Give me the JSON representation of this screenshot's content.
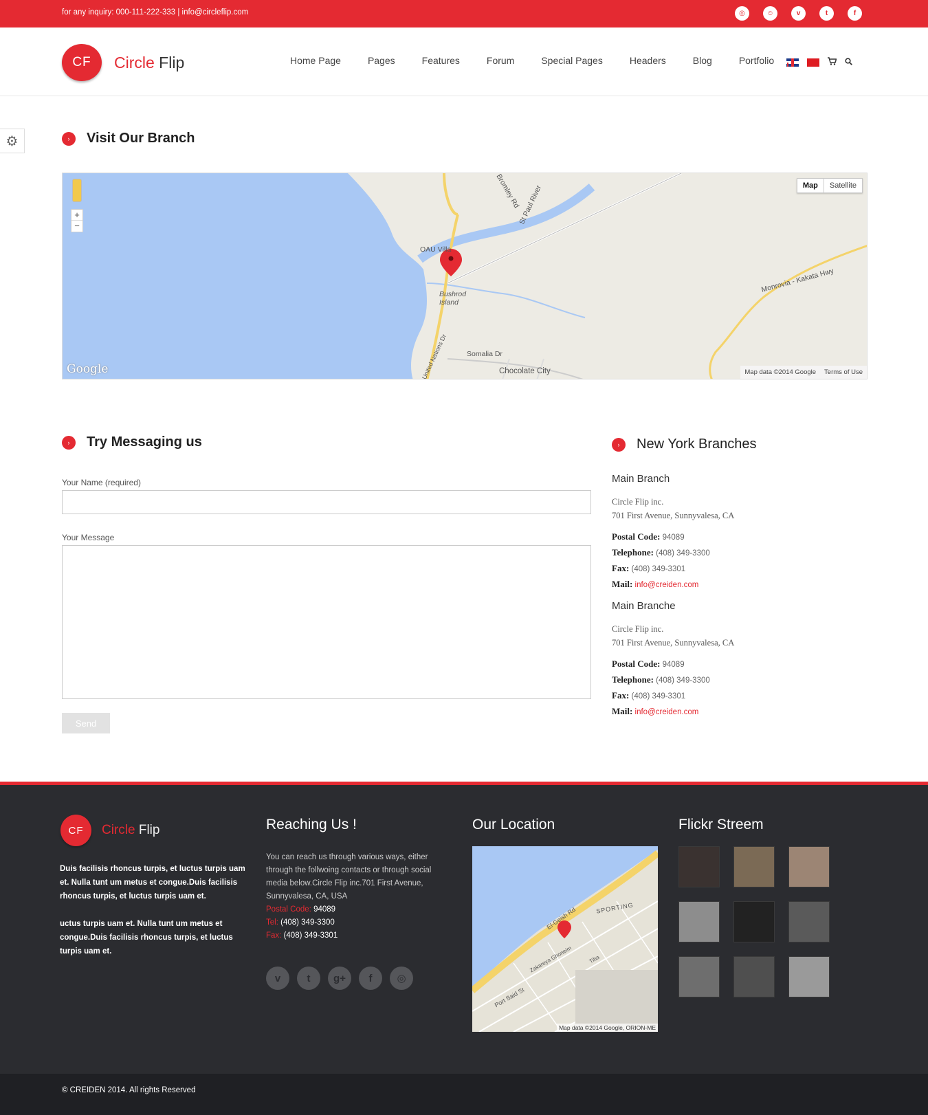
{
  "topbar": {
    "inquiry": "for any inquiry: 000-111-222-333 | info@circleflip.com",
    "socials": [
      "dribbble-icon",
      "reddit-icon",
      "vimeo-icon",
      "twitter-icon",
      "facebook-icon"
    ]
  },
  "logo": {
    "mark": "CF",
    "name_a": "Circle",
    "name_b": "Flip"
  },
  "nav": {
    "items": [
      "Home Page",
      "Pages",
      "Features",
      "Forum",
      "Special Pages",
      "Headers",
      "Blog",
      "Portfolio"
    ]
  },
  "branch_section": {
    "title": "Visit Our Branch",
    "map": {
      "btn_map": "Map",
      "btn_satellite": "Satellite",
      "zoom_in": "+",
      "zoom_out": "−",
      "google": "Google",
      "data": "Map data ©2014 Google",
      "terms": "Terms of Use",
      "labels": [
        "Bromley Rd",
        "St Paul River",
        "OAU Villa",
        "Bushrod Island",
        "Monrovia - Kakata Hwy",
        "Somalia Dr",
        "Chocolate City",
        "United Nations Dr"
      ]
    }
  },
  "contact": {
    "title": "Try Messaging us",
    "name_label": "Your Name (required)",
    "message_label": "Your Message",
    "send": "Send"
  },
  "branches": {
    "title": "New York Branches",
    "list": [
      {
        "name": "Main Branch",
        "line1": "Circle Flip inc.",
        "line2": "701 First Avenue, Sunnyvalesa, CA",
        "postal_label": "Postal Code:",
        "postal": "94089",
        "tel_label": "Telephone:",
        "tel": "(408) 349-3300",
        "fax_label": "Fax:",
        "fax": "(408) 349-3301",
        "mail_label": "Mail:",
        "mail": "info@creiden.com"
      },
      {
        "name": "Main Branche",
        "line1": "Circle Flip inc.",
        "line2": "701 First Avenue, Sunnyvalesa, CA",
        "postal_label": "Postal Code:",
        "postal": "94089",
        "tel_label": "Telephone:",
        "tel": "(408) 349-3300",
        "fax_label": "Fax:",
        "fax": "(408) 349-3301",
        "mail_label": "Mail:",
        "mail": "info@creiden.com"
      }
    ]
  },
  "footer": {
    "about_p1": "Duis facilisis rhoncus turpis, et luctus turpis uam et. Nulla tunt um metus et congue.Duis facilisis rhoncus turpis, et luctus turpis uam et.",
    "about_p2": "uctus turpis uam et. Nulla tunt um metus et congue.Duis facilisis rhoncus turpis, et luctus turpis uam et.",
    "reach_title": "Reaching Us !",
    "reach_text": "You can reach us through various ways, either through the follwoing contacts or through social media below.Circle Flip inc.701 First Avenue, Sunnyvalesa, CA, USA",
    "postal_label": "Postal Code:",
    "postal": "94089",
    "tel_label": "Tel:",
    "tel": "(408) 349-3300",
    "fax_label": "Fax:",
    "fax": "(408) 349-3301",
    "socials": [
      "vimeo-icon",
      "twitter-icon",
      "google-plus-icon",
      "facebook-icon",
      "dribbble-icon"
    ],
    "location_title": "Our Location",
    "location_map_data": "Map data ©2014 Google, ORION-ME",
    "location_labels": [
      "El-Geish Rd",
      "Port Said St",
      "Zakareya Ghoneim",
      "SPORTING",
      "Tiba"
    ],
    "flickr_title": "Flickr Streem",
    "copyright": "© CREIDEN 2014. All rights Reserved"
  },
  "colors": {
    "accent": "#e42a32",
    "footer_bg": "#2b2c30",
    "bottom_bg": "#1f2024",
    "water": "#a9c8f4",
    "road": "#f4d36a"
  }
}
